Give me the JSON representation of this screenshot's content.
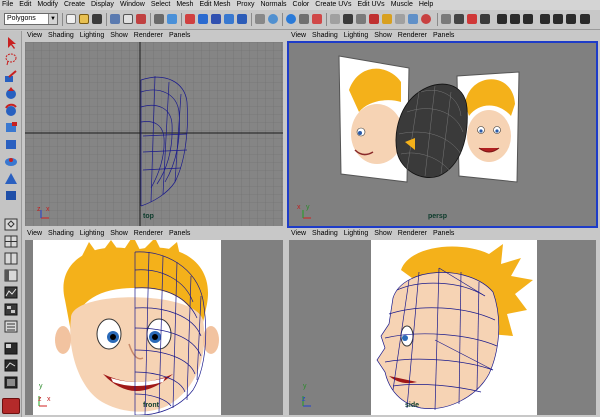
{
  "menubar": {
    "items": [
      "File",
      "Edit",
      "Modify",
      "Create",
      "Display",
      "Window",
      "Select",
      "Mesh",
      "Edit Mesh",
      "Proxy",
      "Normals",
      "Color",
      "Create UVs",
      "Edit UVs",
      "Muscle",
      "Help"
    ]
  },
  "toolbar": {
    "mode_value": "Polygons",
    "mode_options": [
      "Polygons"
    ],
    "icons": [
      "menu-set-icon",
      "new-scene-icon",
      "open-scene-icon",
      "save-scene-icon",
      "select-hierarchy-icon",
      "select-object-icon",
      "select-component-icon",
      "snap-grid-icon",
      "snap-curve-icon",
      "snap-point-icon",
      "snap-surface-icon",
      "history-icon",
      "render-icon",
      "ipr-render-icon",
      "render-settings-icon",
      "hypershade-icon",
      "attribute-editor-icon",
      "tool-settings-icon",
      "channel-box-icon"
    ]
  },
  "toolbox": {
    "tools": [
      "select-tool-icon",
      "lasso-tool-icon",
      "paint-select-icon",
      "move-tool-icon",
      "rotate-tool-icon",
      "scale-tool-icon",
      "manipulator-icon",
      "soft-mod-icon",
      "show-manipulator-icon",
      "last-tool-icon",
      "layout-single-icon",
      "layout-four-icon",
      "layout-two-icon",
      "layout-persp-outliner-icon",
      "layout-persp-graph-icon",
      "layout-hypershade-icon",
      "outliner-icon"
    ]
  },
  "panels": {
    "menu": [
      "View",
      "Shading",
      "Lighting",
      "Show",
      "Renderer",
      "Panels"
    ],
    "top": {
      "camera": "top"
    },
    "persp": {
      "camera": "persp"
    },
    "front": {
      "camera": "front"
    },
    "side": {
      "camera": "side"
    }
  },
  "axes": {
    "x": "x",
    "y": "y",
    "z": "z"
  },
  "colors": {
    "active_border": "#1e3cc8",
    "wire": "#1a1a8c",
    "viewport_bg": "#808080",
    "hair": "#f4b11a",
    "skin": "#f6d3b4"
  }
}
